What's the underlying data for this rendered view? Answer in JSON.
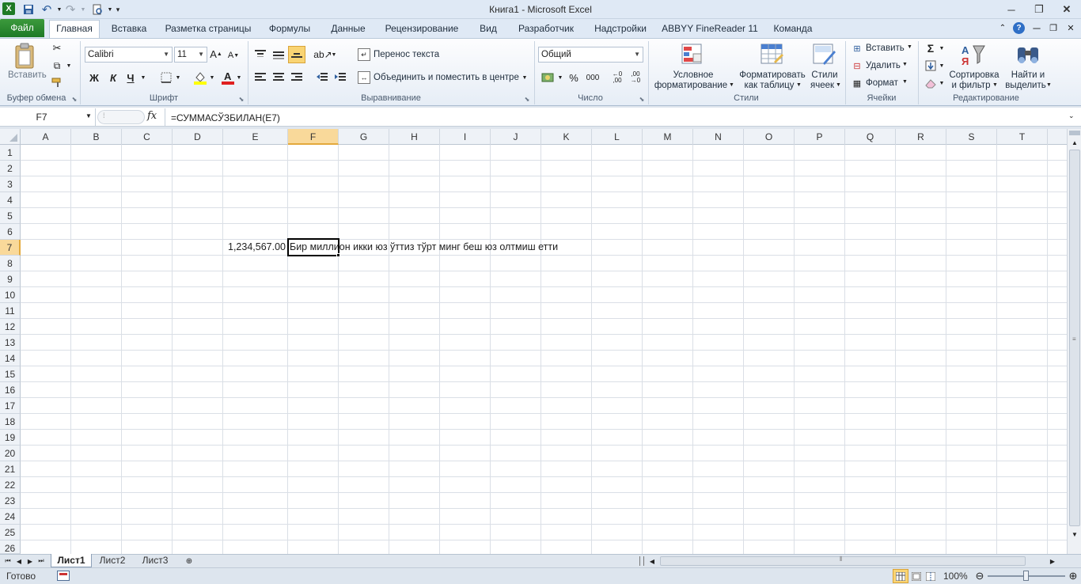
{
  "window": {
    "title": "Книга1  -  Microsoft Excel"
  },
  "tabs": {
    "file": "Файл",
    "items": [
      "Главная",
      "Вставка",
      "Разметка страницы",
      "Формулы",
      "Данные",
      "Рецензирование",
      "Вид",
      "Разработчик",
      "Надстройки",
      "ABBYY FineReader 11",
      "Команда"
    ]
  },
  "ribbon": {
    "clipboard": {
      "paste": "Вставить",
      "label": "Буфер обмена"
    },
    "font": {
      "name": "Calibri",
      "size": "11",
      "bold": "Ж",
      "italic": "К",
      "underline": "Ч",
      "label": "Шрифт"
    },
    "alignment": {
      "wrap": "Перенос текста",
      "merge": "Объединить и поместить в центре",
      "label": "Выравнивание"
    },
    "number": {
      "format": "Общий",
      "percent": "%",
      "thousands": "000",
      "label": "Число"
    },
    "styles": {
      "conditional_1": "Условное",
      "conditional_2": "форматирование",
      "table_1": "Форматировать",
      "table_2": "как таблицу",
      "cell_1": "Стили",
      "cell_2": "ячеек",
      "label": "Стили"
    },
    "cells": {
      "insert": "Вставить",
      "delete": "Удалить",
      "format": "Формат",
      "label": "Ячейки"
    },
    "editing": {
      "sort_1": "Сортировка",
      "sort_2": "и фильтр",
      "find_1": "Найти и",
      "find_2": "выделить",
      "label": "Редактирование"
    }
  },
  "formula_bar": {
    "name_box": "F7",
    "fx": "fx",
    "formula": "=СУММАСЎЗБИЛАН(E7)"
  },
  "grid": {
    "columns": [
      "A",
      "B",
      "C",
      "D",
      "E",
      "F",
      "G",
      "H",
      "I",
      "J",
      "K",
      "L",
      "M",
      "N",
      "O",
      "P",
      "Q",
      "R",
      "S",
      "T"
    ],
    "rows": [
      "1",
      "2",
      "3",
      "4",
      "5",
      "6",
      "7",
      "8",
      "9",
      "10",
      "11",
      "12",
      "13",
      "14",
      "15",
      "16",
      "17",
      "18",
      "19",
      "20",
      "21",
      "22",
      "23",
      "24",
      "25",
      "26"
    ],
    "selected_cell": "F7",
    "cells": {
      "E7": "1,234,567.00",
      "F7": "Бир миллион икки юз ўттиз тўрт минг беш юз олтмиш етти"
    }
  },
  "sheets": [
    "Лист1",
    "Лист2",
    "Лист3"
  ],
  "status": {
    "ready": "Готово",
    "zoom": "100%"
  },
  "colors": {
    "accent": "#1e7a26",
    "selected_header": "#f9d99a",
    "grid_line": "#dadfe6"
  }
}
